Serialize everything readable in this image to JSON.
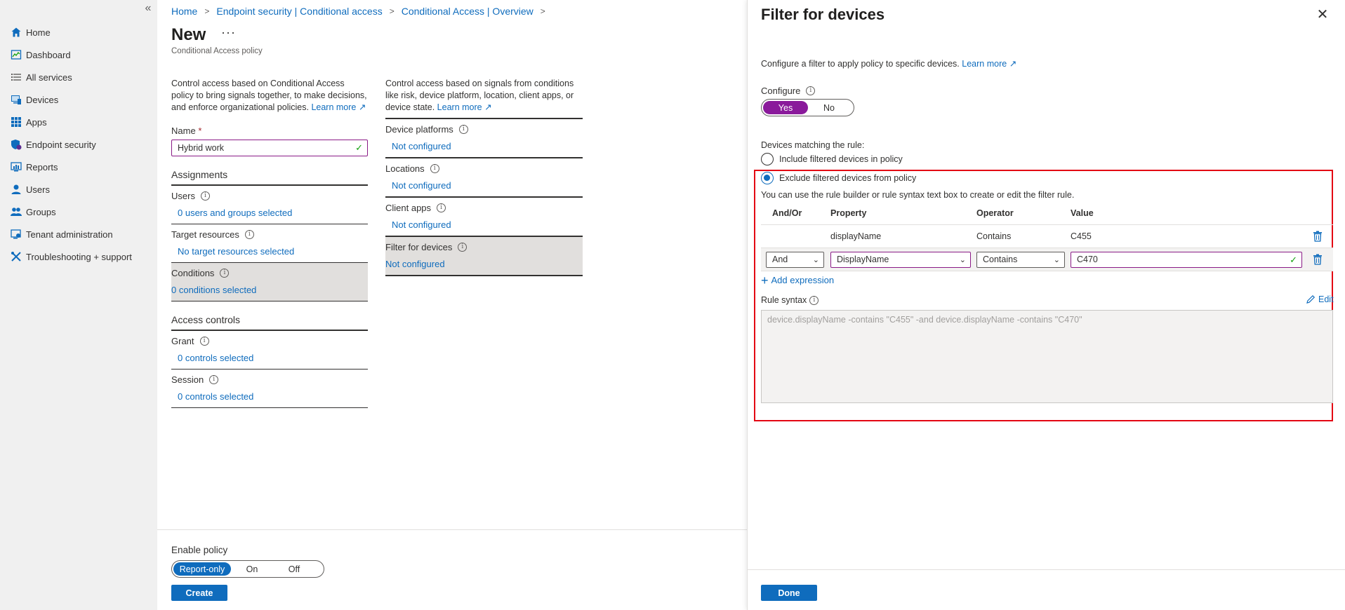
{
  "sidebar": {
    "collapse_label": "«",
    "items": [
      {
        "label": "Home",
        "icon": "home-icon"
      },
      {
        "label": "Dashboard",
        "icon": "dashboard-icon"
      },
      {
        "label": "All services",
        "icon": "list-icon"
      },
      {
        "label": "Devices",
        "icon": "devices-icon"
      },
      {
        "label": "Apps",
        "icon": "apps-grid-icon"
      },
      {
        "label": "Endpoint security",
        "icon": "shield-icon"
      },
      {
        "label": "Reports",
        "icon": "reports-icon"
      },
      {
        "label": "Users",
        "icon": "user-icon"
      },
      {
        "label": "Groups",
        "icon": "groups-icon"
      },
      {
        "label": "Tenant administration",
        "icon": "tenant-icon"
      },
      {
        "label": "Troubleshooting + support",
        "icon": "tools-icon"
      }
    ]
  },
  "breadcrumb": [
    "Home",
    "Endpoint security | Conditional access",
    "Conditional Access | Overview"
  ],
  "page": {
    "title": "New",
    "more": "···",
    "subtitle": "Conditional Access policy"
  },
  "left": {
    "description": "Control access based on Conditional Access policy to bring signals together, to make decisions, and enforce organizational policies.",
    "learn_more": "Learn more",
    "name_label": "Name",
    "name_required": "*",
    "name_value": "Hybrid work",
    "assignments": "Assignments",
    "users_label": "Users",
    "users_value": "0 users and groups selected",
    "target_label": "Target resources",
    "target_value": "No target resources selected",
    "conditions_label": "Conditions",
    "conditions_value": "0 conditions selected",
    "access_controls": "Access controls",
    "grant_label": "Grant",
    "grant_value": "0 controls selected",
    "session_label": "Session",
    "session_value": "0 controls selected"
  },
  "right": {
    "description": "Control access based on signals from conditions like risk, device platform, location, client apps, or device state.",
    "learn_more": "Learn more",
    "device_platforms_label": "Device platforms",
    "device_platforms_value": "Not configured",
    "locations_label": "Locations",
    "locations_value": "Not configured",
    "client_apps_label": "Client apps",
    "client_apps_value": "Not configured",
    "filter_label": "Filter for devices",
    "filter_value": "Not configured"
  },
  "footer": {
    "enable_label": "Enable policy",
    "options": [
      "Report-only",
      "On",
      "Off"
    ],
    "selected": "Report-only",
    "create": "Create"
  },
  "panel": {
    "title": "Filter for devices",
    "description": "Configure a filter to apply policy to specific devices.",
    "learn_more": "Learn more",
    "configure_label": "Configure",
    "toggle_yes": "Yes",
    "toggle_no": "No",
    "matching_label": "Devices matching the rule:",
    "include_option": "Include filtered devices in policy",
    "exclude_option": "Exclude filtered devices from policy",
    "help_text": "You can use the rule builder or rule syntax text box to create or edit the filter rule.",
    "columns": [
      "And/Or",
      "Property",
      "Operator",
      "Value"
    ],
    "row1": {
      "andor": "",
      "property": "displayName",
      "operator": "Contains",
      "value": "C455"
    },
    "row2": {
      "andor": "And",
      "property": "DisplayName",
      "operator": "Contains",
      "value": "C470"
    },
    "add_expression": "Add expression",
    "rule_syntax_label": "Rule syntax",
    "edit": "Edit",
    "rule_syntax": "device.displayName -contains \"C455\" -and device.displayName -contains \"C470\"",
    "done": "Done"
  },
  "colors": {
    "accent": "#0f6cbd",
    "toggle_selected": "#8a1a9b",
    "highlight_box": "#e30613"
  }
}
